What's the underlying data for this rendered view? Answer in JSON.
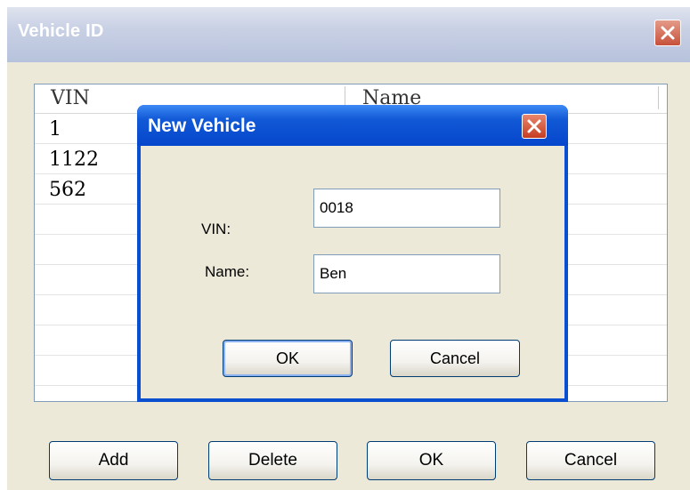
{
  "outer_dialog": {
    "title": "Vehicle ID",
    "columns": [
      "VIN",
      "Name"
    ],
    "rows": [
      {
        "vin": "1",
        "name": ""
      },
      {
        "vin": "1122",
        "name": ""
      },
      {
        "vin": "562",
        "name": ""
      }
    ],
    "buttons": {
      "add": "Add",
      "delete": "Delete",
      "ok": "OK",
      "cancel": "Cancel"
    }
  },
  "inner_dialog": {
    "title": "New Vehicle",
    "vin_label": "VIN:",
    "vin_value": "0018",
    "name_label": "Name:",
    "name_value": "Ben",
    "buttons": {
      "ok": "OK",
      "cancel": "Cancel"
    }
  },
  "icons": {
    "close": "close-icon"
  },
  "colors": {
    "xp_blue_title": "#0a4fd0",
    "close_red": "#c43d22",
    "dialog_bg": "#ece9d8"
  }
}
